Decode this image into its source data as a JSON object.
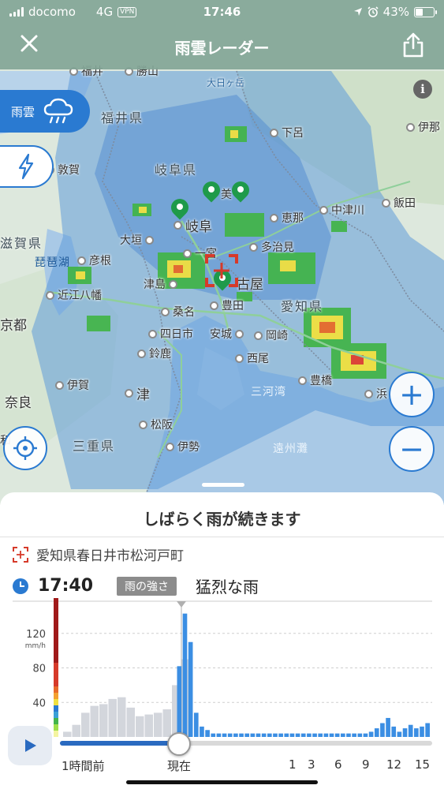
{
  "status_bar": {
    "carrier": "docomo",
    "network": "4G",
    "vpn": "VPN",
    "time": "17:46",
    "battery": "43%"
  },
  "header": {
    "title": "雨雲レーダー",
    "close_icon": "close-icon",
    "share_icon": "share-icon"
  },
  "layers": {
    "rain_label": "雨雲",
    "rain_icon": "rain-cloud-icon",
    "lightning_icon": "lightning-icon"
  },
  "map": {
    "info": "i",
    "places": {
      "fukui_city": "福井",
      "katsuyama": "勝山",
      "fukui_pref": "福井県",
      "oonogahara": "大日ヶ岳",
      "shimoro": "下呂",
      "iga_hara": "伊那",
      "gifu_pref": "岐阜県",
      "tsuruga": "敦賀",
      "mino": "美",
      "gifu": "岐阜",
      "ena": "恵那",
      "nakatsugawa": "中津川",
      "iida": "飯田",
      "shiga_pref": "滋賀県",
      "biwako": "琵琶湖",
      "hikone": "彦根",
      "ogaki": "大垣",
      "tajimi": "多治見",
      "ichinomiya": "一宮",
      "tsushima": "津島",
      "nagoya": "古屋",
      "omi_hachiman": "近江八幡",
      "kuwana": "桑名",
      "toyota": "豊田",
      "aichi_pref": "愛知県",
      "kyoto": "京都",
      "yokkaichi": "四日市",
      "anjo": "安城",
      "okazaki": "岡崎",
      "suzuka": "鈴鹿",
      "nishio": "西尾",
      "toyohashi": "豊橋",
      "hama": "浜",
      "iga": "伊賀",
      "mikawa_bay": "三河湾",
      "nara": "奈良",
      "tsu": "津",
      "matsusaka": "松阪",
      "mie_pref": "三重県",
      "ise": "伊勢",
      "enshu_nada": "遠州灘",
      "wa": "和"
    }
  },
  "controls": {
    "locate_icon": "crosshair-icon",
    "zoom_in": "+",
    "zoom_out": "−"
  },
  "sheet": {
    "headline": "しばらく雨が続きます",
    "location": "愛知県春日井市松河戸町",
    "time": "17:40",
    "badge": "雨の強さ",
    "intensity": "猛烈な雨",
    "play_icon": "play-icon"
  },
  "colors": {
    "accent": "#2a7ad1",
    "past_bar": "#d3d6dc",
    "future_bar": "#3b8ee3",
    "header_bg": "#82a596",
    "pin": "#1f9a4a"
  },
  "chart_data": {
    "type": "bar",
    "ylabel": "mm/h",
    "yticks": [
      40,
      80,
      120
    ],
    "ylim": [
      0,
      150
    ],
    "x_labels": [
      "1時間前",
      "現在",
      "1",
      "3",
      "6",
      "9",
      "12",
      "15"
    ],
    "series": [
      {
        "values": [
          6,
          14,
          28,
          36,
          38,
          44,
          46,
          34,
          24,
          26,
          28,
          32,
          60,
          90
        ]
      },
      {
        "values": [
          82,
          143,
          110,
          28,
          12,
          8,
          4,
          4,
          4,
          4,
          4,
          4,
          4,
          4,
          4,
          4,
          4,
          4,
          4,
          4,
          4,
          4,
          4,
          4,
          4,
          4,
          4,
          4,
          4,
          4,
          4,
          4,
          4,
          4,
          6,
          10,
          16,
          22,
          12,
          6,
          10,
          14,
          10,
          12,
          16
        ]
      }
    ]
  }
}
